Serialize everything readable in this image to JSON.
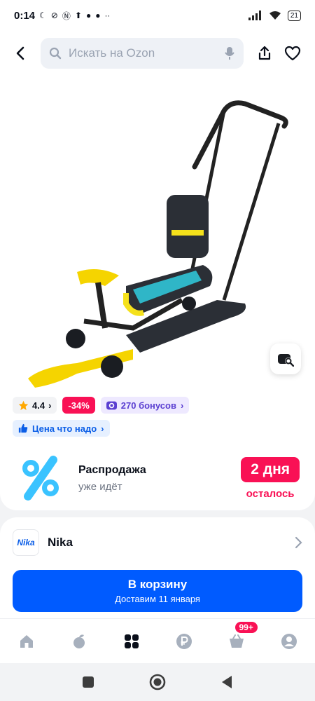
{
  "status_bar": {
    "time": "0:14",
    "battery": "21"
  },
  "search": {
    "placeholder": "Искать на Ozon"
  },
  "product": {
    "rating": "4.4",
    "discount": "-34%",
    "bonus": "270 бонусов",
    "price_tag": "Цена что надо"
  },
  "sale": {
    "title": "Распродажа",
    "subtitle": "уже идёт",
    "timer": "2 дня",
    "timer_sub": "осталось"
  },
  "brand": {
    "logo_text": "Nika",
    "name": "Nika"
  },
  "cta": {
    "title": "В корзину",
    "subtitle": "Доставим 11 января"
  },
  "bottom_nav": {
    "cart_badge": "99+"
  },
  "colors": {
    "brand_blue": "#005bff",
    "sale_pink": "#f91155",
    "bonus_purple": "#5a3ed1"
  },
  "icons": [
    "back-icon",
    "search-icon",
    "mic-icon",
    "share-icon",
    "heart-icon",
    "visual-search-icon",
    "star-icon",
    "thumb-up-icon",
    "chevron-right-icon",
    "home-icon",
    "fresh-icon",
    "catalog-icon",
    "ruble-icon",
    "cart-icon",
    "profile-icon"
  ]
}
